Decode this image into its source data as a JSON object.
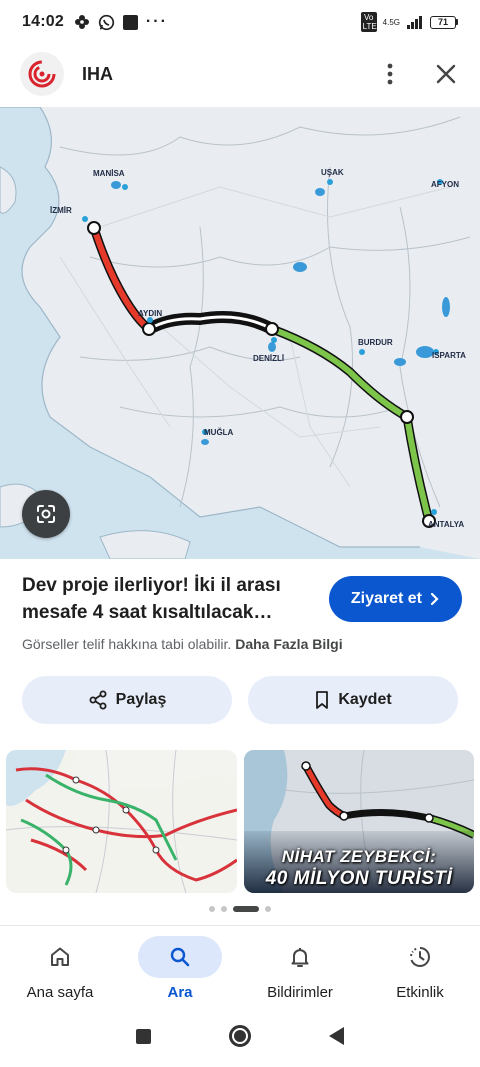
{
  "status_bar": {
    "time": "14:02",
    "network_badge": "Vo LTE",
    "network_type": "4.5G",
    "battery": "71"
  },
  "header": {
    "site_name": "IHA",
    "icons": {
      "menu": "more-vert-icon",
      "close": "close-icon"
    }
  },
  "hero": {
    "map_labels": {
      "izmir": "İZMİR",
      "manisa": "MANİSA",
      "usak": "UŞAK",
      "afyon": "AFYON",
      "aydin": "AYDIN",
      "denizli": "DENİZLİ",
      "burdur": "BURDUR",
      "isparta": "ISPARTA",
      "mugla": "MUĞLA",
      "antalya": "ANTALYA"
    },
    "route_colors": {
      "izmir_aydin": "#e53a2a",
      "aydin_denizli": "#111111",
      "denizli_antalya": "#7dc54a"
    }
  },
  "result": {
    "title": "Dev proje ilerliyor! İki il arası mesafe 4 saat kısaltılacak…",
    "visit_label": "Ziyaret et",
    "copyright_text": "Görseller telif hakkına tabi olabilir.",
    "more_info_label": "Daha Fazla Bilgi"
  },
  "actions": {
    "share_label": "Paylaş",
    "save_label": "Kaydet"
  },
  "related": {
    "thumb2_caption_line1": "NİHAT ZEYBEKCİ:",
    "thumb2_caption_line2": "40 MİLYON TURİSTİ"
  },
  "bottom_nav": {
    "items": [
      {
        "label": "Ana sayfa",
        "icon": "home-icon"
      },
      {
        "label": "Ara",
        "icon": "search-icon"
      },
      {
        "label": "Bildirimler",
        "icon": "bell-icon"
      },
      {
        "label": "Etkinlik",
        "icon": "activity-icon"
      }
    ],
    "active_index": 1
  },
  "colors": {
    "accent": "#0b57d0",
    "chip_bg": "#e8eef9"
  }
}
